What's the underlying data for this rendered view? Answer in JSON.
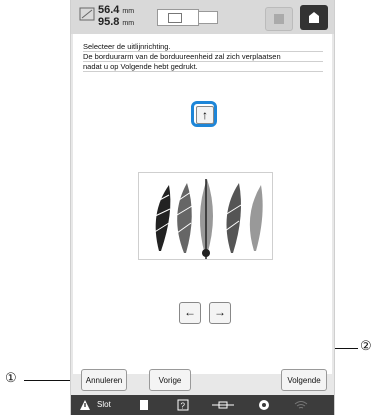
{
  "header": {
    "width_value": "56.4",
    "height_value": "95.8",
    "unit": "mm"
  },
  "message": {
    "line1": "Selecteer de uitlijnrichting.",
    "line2": "De borduurarm van de borduureenheid zal zich verplaatsen",
    "line3": "nadat u op Volgende hebt gedrukt."
  },
  "arrows": {
    "up": "↑",
    "left": "←",
    "right": "→"
  },
  "buttons": {
    "cancel": "Annuleren",
    "previous": "Vorige",
    "next": "Volgende"
  },
  "statusbar": {
    "slot_label": "Slot"
  },
  "callouts": {
    "one": "①",
    "two": "②"
  },
  "colors": {
    "accent": "#1e86d8",
    "statusbar": "#3c3c3c"
  }
}
